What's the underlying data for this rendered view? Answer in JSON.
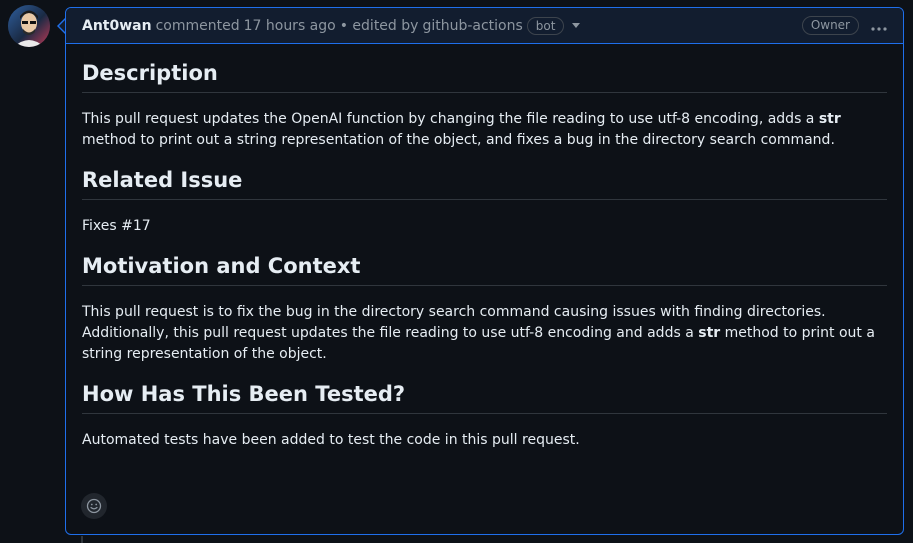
{
  "comment": {
    "author": "Ant0wan",
    "action": "commented",
    "time": "17 hours ago",
    "edited_prefix": "• edited by",
    "editor": "github-actions",
    "bot_badge": "bot",
    "owner_badge": "Owner"
  },
  "body": {
    "sections": [
      {
        "heading": "Description",
        "paragraph": {
          "before": "This pull request updates the OpenAI function by changing the file reading to use utf-8 encoding, adds a ",
          "bold": "str",
          "after": " method to print out a string representation of the object, and fixes a bug in the directory search command."
        }
      },
      {
        "heading": "Related Issue",
        "paragraph": {
          "text": "Fixes #17"
        }
      },
      {
        "heading": "Motivation and Context",
        "paragraph": {
          "before": "This pull request is to fix the bug in the directory search command causing issues with finding directories. Additionally, this pull request updates the file reading to use utf-8 encoding and adds a ",
          "bold": "str",
          "after": " method to print out a string representation of the object."
        }
      },
      {
        "heading": "How Has This Been Tested?",
        "paragraph": {
          "text": "Automated tests have been added to test the code in this pull request."
        }
      }
    ]
  },
  "colors": {
    "background": "#0d1117",
    "accent_border": "#1f6feb",
    "header_bg": "#121d2f"
  },
  "icons": {
    "avatar": "avatar",
    "dropdown": "triangle-down-icon",
    "kebab": "kebab-horizontal-icon",
    "reaction": "smiley-icon"
  }
}
